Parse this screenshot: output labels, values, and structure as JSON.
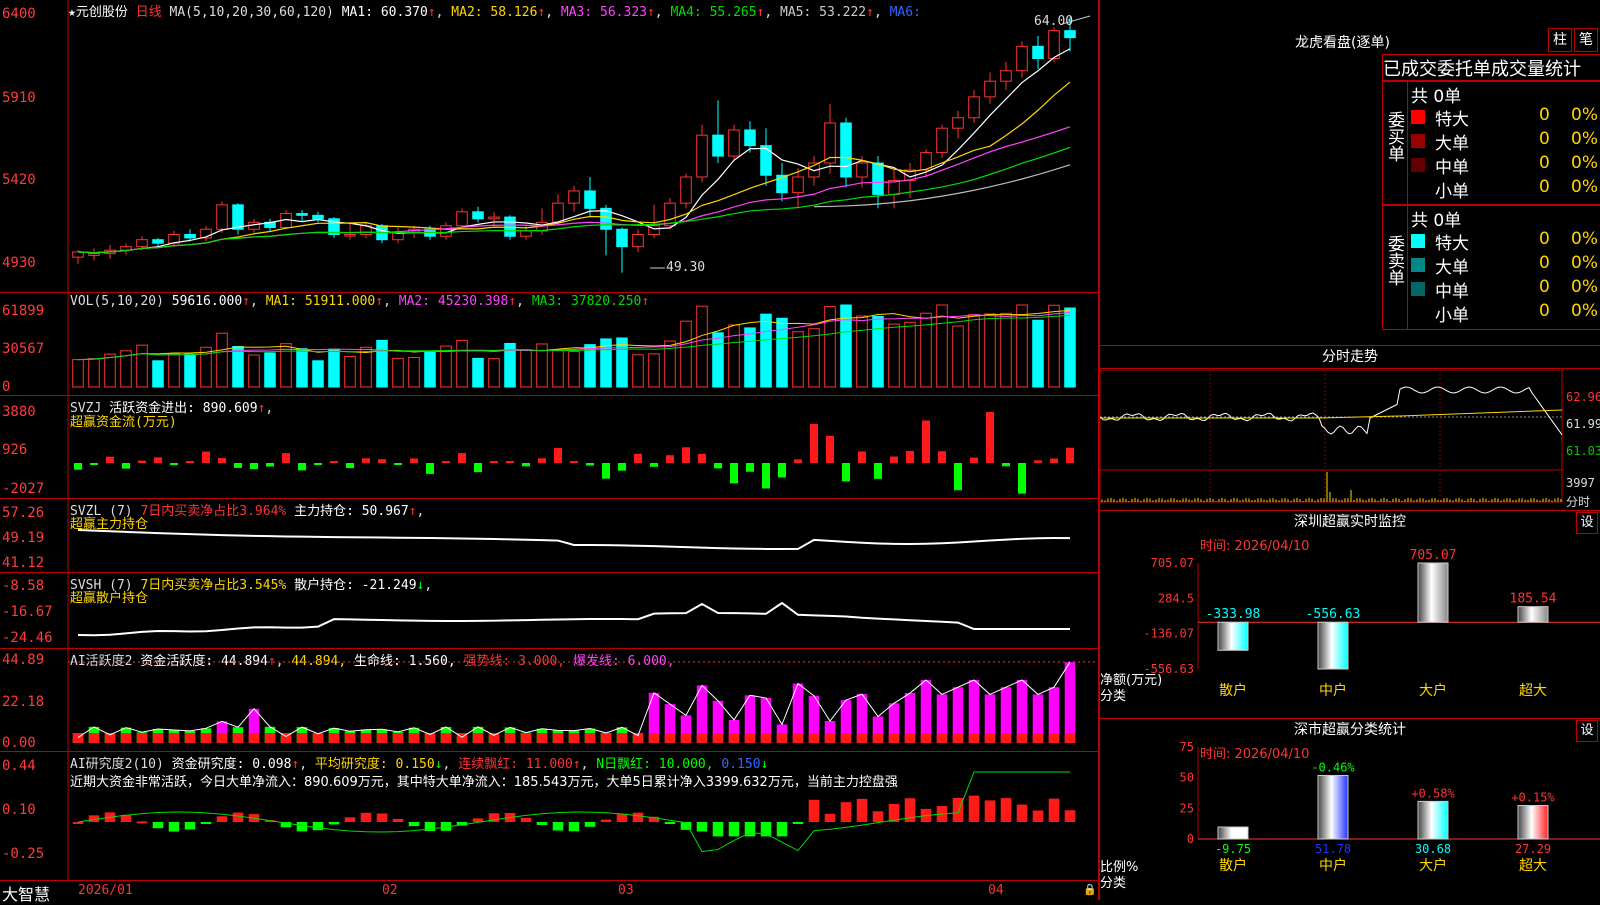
{
  "main": {
    "header_star": "★",
    "stock_name": "元创股份",
    "period": "日线",
    "ma_label": "MA(5,10,20,30,60,120)",
    "ma": [
      {
        "label": "MA1: 60.370",
        "color": "#ffffff"
      },
      {
        "label": "MA2: 58.126",
        "color": "#ffd700"
      },
      {
        "label": "MA3: 56.323",
        "color": "#ff44ff"
      },
      {
        "label": "MA4: 55.265",
        "color": "#00dd00"
      },
      {
        "label": "MA5: 53.222",
        "color": "#cccccc"
      },
      {
        "label": "MA6:",
        "color": "#3366ff"
      }
    ],
    "y_ticks": [
      "6400",
      "5910",
      "5420",
      "4930"
    ],
    "high_label": "64.00",
    "low_label": "49.30"
  },
  "vol": {
    "title": "VOL(5,10,20)",
    "value": "59616.000",
    "ma1": "MA1: 51911.000",
    "ma2": "MA2: 45230.398",
    "ma3": "MA3: 37820.250",
    "y_ticks": [
      "61899",
      "30567",
      "0"
    ]
  },
  "svzj": {
    "title": "SVZJ",
    "label": "活跃资金进出: 890.609",
    "sub": "超赢资金流(万元)",
    "y_ticks": [
      "3880",
      "926",
      "-2027"
    ]
  },
  "svzl": {
    "title": "SVZL (7)",
    "label1": "7日内买卖净占比3.964%",
    "label2": "主力持仓: 50.967",
    "sub": "超赢主力持仓",
    "y_ticks": [
      "57.26",
      "49.19",
      "41.12"
    ]
  },
  "svsh": {
    "title": "SVSH (7)",
    "label1": "7日内买卖净占比3.545%",
    "label2": "散户持仓: -21.249",
    "sub": "超赢散户持仓",
    "y_ticks": [
      "-8.58",
      "-16.67",
      "-24.46"
    ]
  },
  "ai1": {
    "title": "AI活跃度2",
    "l1": "资金活跃度: 44.894",
    "l2": "44.894,",
    "l3": "生命线: 1.560,",
    "l4": "强势线: 3.000,",
    "l5": "爆发线: 6.000,",
    "y_ticks": [
      "44.89",
      "22.18",
      "0.00"
    ]
  },
  "ai2": {
    "title": "AI研究度2(10)",
    "l1": "资金研究度: 0.098",
    "l2": "平均研究度: 0.150",
    "l3": "连续飘红: 11.000",
    "l4": "N日飘红: 10.000,",
    "l5": "0.150",
    "comment": "近期大资金非常活跃，今日大单净流入：890.609万元，其中特大单净流入：185.543万元，大单5日累计净入3399.632万元，当前主力控盘强",
    "y_ticks": [
      "0.44",
      "0.10",
      "-0.25"
    ]
  },
  "footer": {
    "brand": "大智慧",
    "dates": [
      "2026/01",
      "02",
      "03",
      "04"
    ]
  },
  "dragon": {
    "title": "龙虎看盘(逐单)",
    "btn_bar": "柱",
    "btn_line": "笔",
    "tabs": "已成交委托单成交量统计",
    "buy_title": "委买单",
    "sell_title": "委卖单",
    "buy_total": "共 0单",
    "sell_total": "共 0单",
    "buy_rows": [
      {
        "name": "特大",
        "count": "0",
        "pct": "0%",
        "color": "#ff0000"
      },
      {
        "name": "大单",
        "count": "0",
        "pct": "0%",
        "color": "#990000"
      },
      {
        "name": "中单",
        "count": "0",
        "pct": "0%",
        "color": "#660000"
      },
      {
        "name": "小单",
        "count": "0",
        "pct": "0%",
        "color": "#000000"
      }
    ],
    "sell_rows": [
      {
        "name": "特大",
        "count": "0",
        "pct": "0%",
        "color": "#00ffff"
      },
      {
        "name": "大单",
        "count": "0",
        "pct": "0%",
        "color": "#008888"
      },
      {
        "name": "中单",
        "count": "0",
        "pct": "0%",
        "color": "#006666"
      },
      {
        "name": "小单",
        "count": "0",
        "pct": "0%",
        "color": "#000000"
      }
    ]
  },
  "intraday": {
    "title": "分时走势",
    "y_labels": [
      "62.96",
      "61.99",
      "61.03"
    ],
    "vol_label": "3997",
    "vol_unit": "分时"
  },
  "sz_monitor": {
    "title": "深圳超赢实时监控",
    "set": "设",
    "time": "时间: 2026/04/10",
    "y_ticks": [
      "705.07",
      "284.5",
      "-136.07",
      "-556.63"
    ],
    "bars": [
      {
        "cat": "散户",
        "value": -333.98,
        "label": "-333.98"
      },
      {
        "cat": "中户",
        "value": -556.63,
        "label": "-556.63"
      },
      {
        "cat": "大户",
        "value": 705.07,
        "label": "705.07"
      },
      {
        "cat": "超大",
        "value": 185.54,
        "label": "185.54"
      }
    ],
    "side_label1": "净额(万元)",
    "side_label2": "分类"
  },
  "sz_class": {
    "title": "深市超赢分类统计",
    "set": "设",
    "time": "时间: 2026/04/10",
    "y_ticks": [
      "75",
      "50",
      "25",
      "0"
    ],
    "bars": [
      {
        "cat": "散户",
        "value": 9.75,
        "change": "",
        "label": "-9.75"
      },
      {
        "cat": "中户",
        "value": 51.78,
        "change": "-0.46%",
        "label": "51.78"
      },
      {
        "cat": "大户",
        "value": 30.68,
        "change": "+0.58%",
        "label": "30.68"
      },
      {
        "cat": "超大",
        "value": 27.29,
        "change": "+0.15%",
        "label": "27.29"
      }
    ],
    "side_label1": "比例%",
    "side_label2": "分类"
  },
  "candles": [
    [
      50.2,
      50.5,
      49.8,
      50.6
    ],
    [
      50.3,
      50.4,
      50.0,
      50.7
    ],
    [
      50.4,
      50.6,
      50.1,
      50.9
    ],
    [
      50.6,
      50.8,
      50.3,
      51.0
    ],
    [
      50.8,
      51.2,
      50.6,
      51.4
    ],
    [
      51.2,
      51.0,
      50.7,
      51.3
    ],
    [
      51.0,
      51.5,
      50.8,
      51.7
    ],
    [
      51.5,
      51.3,
      51.1,
      51.8
    ],
    [
      51.3,
      51.8,
      51.1,
      52.0
    ],
    [
      51.8,
      53.2,
      51.6,
      53.4
    ],
    [
      53.2,
      51.8,
      51.5,
      53.3
    ],
    [
      51.8,
      52.2,
      51.6,
      52.4
    ],
    [
      52.2,
      51.9,
      51.7,
      52.4
    ],
    [
      51.9,
      52.7,
      51.8,
      52.9
    ],
    [
      52.7,
      52.6,
      52.2,
      52.9
    ],
    [
      52.6,
      52.4,
      52.2,
      52.8
    ],
    [
      52.4,
      51.5,
      51.3,
      52.5
    ],
    [
      51.5,
      51.5,
      51.2,
      52.2
    ],
    [
      51.5,
      52.0,
      51.3,
      52.2
    ],
    [
      52.0,
      51.2,
      51.0,
      52.1
    ],
    [
      51.2,
      51.6,
      51.0,
      51.9
    ],
    [
      51.6,
      51.8,
      51.3,
      52.0
    ],
    [
      51.8,
      51.4,
      51.2,
      52.0
    ],
    [
      51.4,
      52.0,
      51.2,
      52.2
    ],
    [
      52.0,
      52.8,
      51.8,
      53.0
    ],
    [
      52.8,
      52.4,
      52.2,
      53.1
    ],
    [
      52.4,
      52.5,
      52.0,
      52.8
    ],
    [
      52.5,
      51.4,
      51.2,
      52.6
    ],
    [
      51.4,
      51.7,
      51.2,
      52.0
    ],
    [
      51.7,
      52.2,
      51.5,
      53.0
    ],
    [
      52.2,
      53.3,
      52.0,
      53.8
    ],
    [
      53.3,
      54.0,
      52.8,
      54.3
    ],
    [
      54.0,
      53.0,
      52.5,
      54.8
    ],
    [
      53.0,
      51.8,
      50.3,
      53.2
    ],
    [
      51.8,
      50.8,
      49.3,
      51.9
    ],
    [
      50.8,
      51.5,
      50.5,
      51.8
    ],
    [
      51.5,
      52.0,
      51.3,
      53.2
    ],
    [
      52.0,
      53.3,
      51.8,
      53.6
    ],
    [
      53.3,
      54.8,
      53.0,
      55.0
    ],
    [
      54.8,
      57.2,
      54.5,
      57.8
    ],
    [
      57.2,
      56.0,
      55.6,
      59.2
    ],
    [
      56.0,
      57.5,
      55.8,
      57.8
    ],
    [
      57.5,
      56.6,
      56.2,
      58.0
    ],
    [
      56.6,
      54.9,
      54.3,
      57.6
    ],
    [
      54.9,
      53.9,
      53.4,
      55.6
    ],
    [
      53.9,
      54.8,
      53.0,
      55.3
    ],
    [
      54.8,
      55.6,
      54.3,
      56.0
    ],
    [
      55.6,
      57.9,
      55.0,
      59.0
    ],
    [
      57.9,
      54.8,
      54.2,
      58.2
    ],
    [
      54.8,
      55.6,
      54.2,
      56.0
    ],
    [
      55.6,
      53.8,
      53.0,
      56.0
    ],
    [
      53.8,
      54.6,
      53.0,
      55.2
    ],
    [
      54.6,
      55.2,
      53.6,
      55.6
    ],
    [
      55.2,
      56.2,
      54.8,
      56.4
    ],
    [
      56.2,
      57.6,
      55.9,
      57.8
    ],
    [
      57.6,
      58.2,
      57.0,
      58.6
    ],
    [
      58.2,
      59.4,
      57.9,
      59.8
    ],
    [
      59.4,
      60.3,
      59.0,
      60.8
    ],
    [
      60.3,
      60.9,
      59.8,
      61.4
    ],
    [
      60.9,
      62.3,
      60.5,
      62.6
    ],
    [
      62.3,
      61.6,
      61.0,
      62.9
    ],
    [
      61.6,
      63.2,
      61.4,
      63.4
    ],
    [
      63.2,
      62.8,
      62.0,
      64.0
    ]
  ]
}
